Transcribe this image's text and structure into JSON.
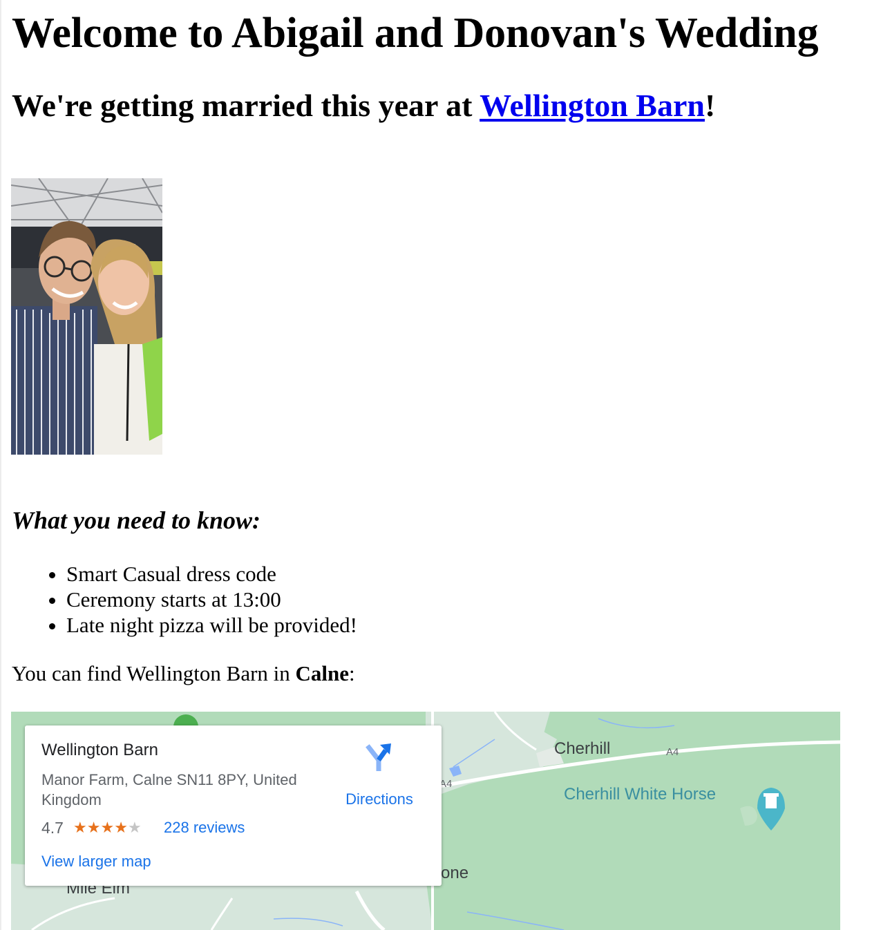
{
  "page": {
    "title": "Welcome to Abigail and Donovan's Wedding",
    "subtitle_prefix": "We're getting married this year at ",
    "venue_link": "Wellington Barn",
    "subtitle_suffix": "!"
  },
  "info": {
    "heading": "What you need to know:",
    "items": [
      "Smart Casual dress code",
      "Ceremony starts at 13:00",
      "Late night pizza will be provided!"
    ]
  },
  "location": {
    "prefix": "You can find Wellington Barn in ",
    "town": "Calne",
    "suffix": ":"
  },
  "map": {
    "card": {
      "name": "Wellington Barn",
      "address": "Manor Farm, Calne SN11 8PY, United Kingdom",
      "rating": "4.7",
      "stars": 4.7,
      "reviews": "228 reviews",
      "directions": "Directions",
      "view_larger": "View larger map"
    },
    "labels": {
      "cherhill": "Cherhill",
      "a4_right": "A4",
      "a4_left": "A4",
      "white_horse": "Cherhill White Horse",
      "mile_elm": "Mile Elm",
      "one": "one"
    },
    "colors": {
      "land": "#b1dbb9",
      "urban": "#d6e6dc",
      "road": "#ffffff",
      "accent": "#1a73e8",
      "star": "#e7711b",
      "poi": "#4bb6c9"
    }
  }
}
